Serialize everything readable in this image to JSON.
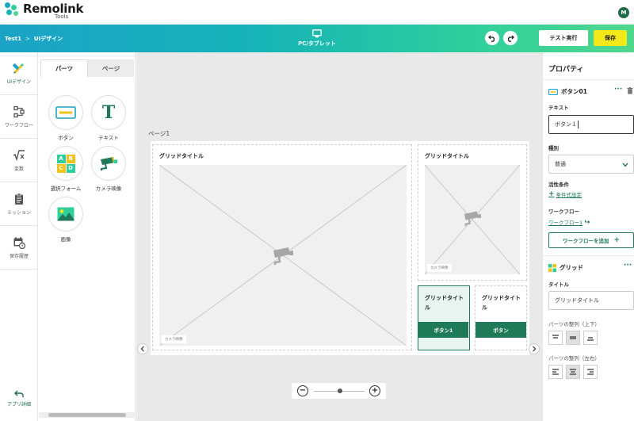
{
  "app": {
    "name": "Remolink",
    "sub": "Tools",
    "user_initial": "M"
  },
  "header": {
    "breadcrumb": [
      "Test1",
      "UIデザイン"
    ],
    "breadcrumb_sep": ">",
    "device_label": "PC/タブレット",
    "test_run": "テスト実行",
    "save": "保存",
    "gradient": [
      "#1ba3c6",
      "#4fd88e"
    ]
  },
  "rail": {
    "items": [
      {
        "label": "UIデザイン",
        "icon": "pencil-ruler-icon",
        "active": true
      },
      {
        "label": "ワークフロー",
        "icon": "workflow-icon",
        "active": false
      },
      {
        "label": "変数",
        "icon": "variable-icon",
        "active": false
      },
      {
        "label": "ミッション",
        "icon": "clipboard-icon",
        "active": false
      },
      {
        "label": "保存履歴",
        "icon": "calendar-history-icon",
        "active": false
      }
    ],
    "back_label": "アプリ詳細"
  },
  "parts_panel": {
    "tabs": [
      "パーツ",
      "ページ"
    ],
    "parts": [
      {
        "label": "ボタン",
        "icon": "button-icon"
      },
      {
        "label": "テキスト",
        "icon": "text-icon"
      },
      {
        "label": "選択フォーム",
        "icon": "select-form-icon"
      },
      {
        "label": "カメラ映像",
        "icon": "camera-icon"
      },
      {
        "label": "画像",
        "icon": "image-icon"
      }
    ],
    "select_letters": [
      "A",
      "B",
      "C",
      "D"
    ],
    "text_glyph": "T"
  },
  "canvas": {
    "page_label": "ページ1",
    "cells": [
      {
        "title": "グリッドタイトル",
        "placeholder_tag": "カメラ映像"
      },
      {
        "title": "グリッドタイトル",
        "placeholder_tag": "カメラ映像"
      },
      {
        "title": "グリッドタイトル",
        "button": "ボタン1"
      },
      {
        "title": "グリッドタイトル",
        "button": "ボタン"
      }
    ],
    "zoom": {
      "minus": "−",
      "plus": "+",
      "level": 0.5
    },
    "accent": "#1f7a5a"
  },
  "properties": {
    "title": "プロパティ",
    "selected": "ボタン01",
    "text_label": "テキスト",
    "text_value": "ボタン１",
    "type_label": "種別",
    "type_value": "普通",
    "active_label": "活性条件",
    "condition_link": "条件式設定",
    "workflow_label": "ワークフロー",
    "workflow_link": "ワークフロー1",
    "add_workflow": "ワークフローを追加",
    "grid_name": "グリッド",
    "title_label": "タイトル",
    "title_value": "グリッドタイトル",
    "align_v_label": "パーツの整列（上下）",
    "align_h_label": "パーツの整列（左右）",
    "dots": "···",
    "plus": "+"
  }
}
